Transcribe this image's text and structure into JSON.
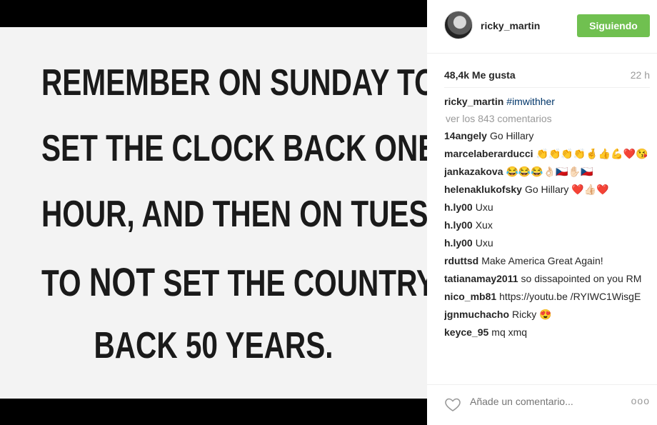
{
  "image": {
    "lines": [
      "REMEMBER ON SUNDAY TO",
      "SET THE CLOCK BACK ONE",
      "HOUR, AND THEN ON TUESDAY",
      "TO",
      "NOT",
      "SET THE COUNTRY",
      "BACK 50 YEARS."
    ]
  },
  "header": {
    "username": "ricky_martin",
    "follow_label": "Siguiendo",
    "follow_color": "#70c050"
  },
  "stats": {
    "likes": "48,4k Me gusta",
    "time": "22 h"
  },
  "caption": {
    "user": "ricky_martin",
    "text": "#imwithher"
  },
  "view_more": "ver los 843 comentarios",
  "comments": [
    {
      "user": "14angely",
      "text": "Go Hillary"
    },
    {
      "user": "marcelaberarducci",
      "text": "👏👏👏👏🤞👍💪❤️😘"
    },
    {
      "user": "jankazakova",
      "text": "😂😂😂👌🏻🇨🇿✋🏻🇨🇿"
    },
    {
      "user": "helenaklukofsky",
      "text": "Go Hillary ❤️👍🏻❤️"
    },
    {
      "user": "h.ly00",
      "text": "Uxu"
    },
    {
      "user": "h.ly00",
      "text": "Xux"
    },
    {
      "user": "h.ly00",
      "text": "Uxu"
    },
    {
      "user": "rduttsd",
      "text": "Make America Great Again!"
    },
    {
      "user": "tatianamay2011",
      "text": "so dissapointed on you RM"
    },
    {
      "user": "nico_mb81",
      "text": "https://youtu.be /RYIWC1WisgE"
    },
    {
      "user": "jgnmuchacho",
      "text": "Ricky 😍"
    },
    {
      "user": "keyce_95",
      "text": "mq xmq"
    }
  ],
  "footer": {
    "add_comment_placeholder": "Añade un comentario...",
    "more_label": "ooo"
  },
  "icons": {
    "heart": "heart-icon",
    "more": "more-options-icon",
    "avatar": "avatar"
  }
}
